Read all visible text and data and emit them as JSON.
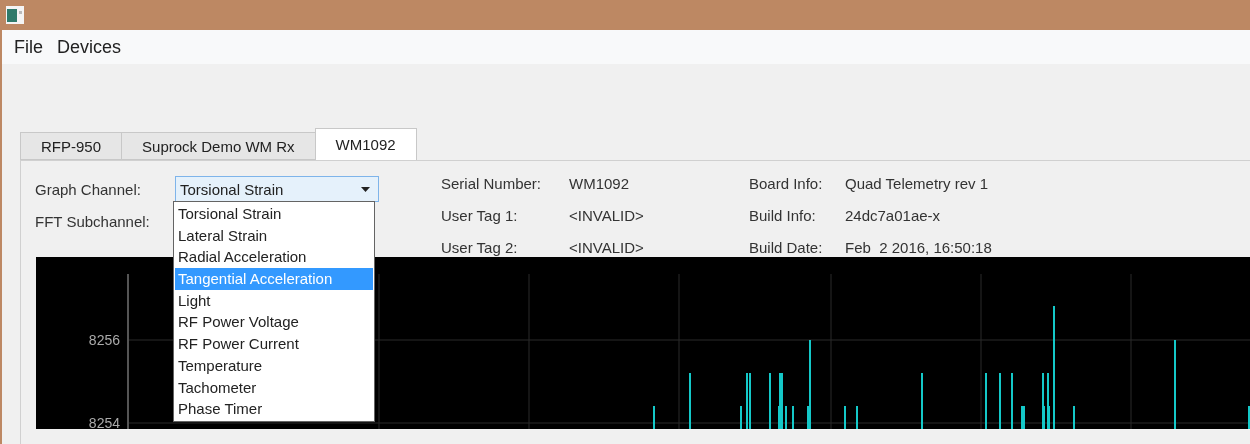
{
  "menu": [
    "File",
    "Devices"
  ],
  "tabs": [
    {
      "label": "RFP-950",
      "selected": false
    },
    {
      "label": "Suprock Demo WM Rx",
      "selected": false
    },
    {
      "label": "WM1092",
      "selected": true
    }
  ],
  "graph_channel": {
    "label": "Graph Channel:",
    "value": "Torsional Strain",
    "expanded": true,
    "options": [
      {
        "label": "Torsional Strain",
        "highlighted": false
      },
      {
        "label": "Lateral Strain",
        "highlighted": false
      },
      {
        "label": "Radial Acceleration",
        "highlighted": false
      },
      {
        "label": "Tangential Acceleration",
        "highlighted": true
      },
      {
        "label": "Light",
        "highlighted": false
      },
      {
        "label": "RF Power Voltage",
        "highlighted": false
      },
      {
        "label": "RF Power Current",
        "highlighted": false
      },
      {
        "label": "Temperature",
        "highlighted": false
      },
      {
        "label": "Tachometer",
        "highlighted": false
      },
      {
        "label": "Phase Timer",
        "highlighted": false
      }
    ]
  },
  "fft_subchannel": {
    "label": "FFT Subchannel:"
  },
  "device_info": [
    {
      "label": "Serial Number:",
      "value": "WM1092"
    },
    {
      "label": "User Tag 1:",
      "value": "<INVALID>"
    },
    {
      "label": "User Tag 2:",
      "value": "<INVALID>"
    }
  ],
  "board_info": [
    {
      "label": "Board Info:",
      "value": "Quad Telemetry rev 1"
    },
    {
      "label": "Build Info:",
      "value": "24dc7a01ae-x"
    },
    {
      "label": "Build Date:",
      "value": "Feb  2 2016, 16:50:18"
    }
  ],
  "plot": {
    "y_tick_labels": [
      "8256",
      "8254"
    ]
  }
}
